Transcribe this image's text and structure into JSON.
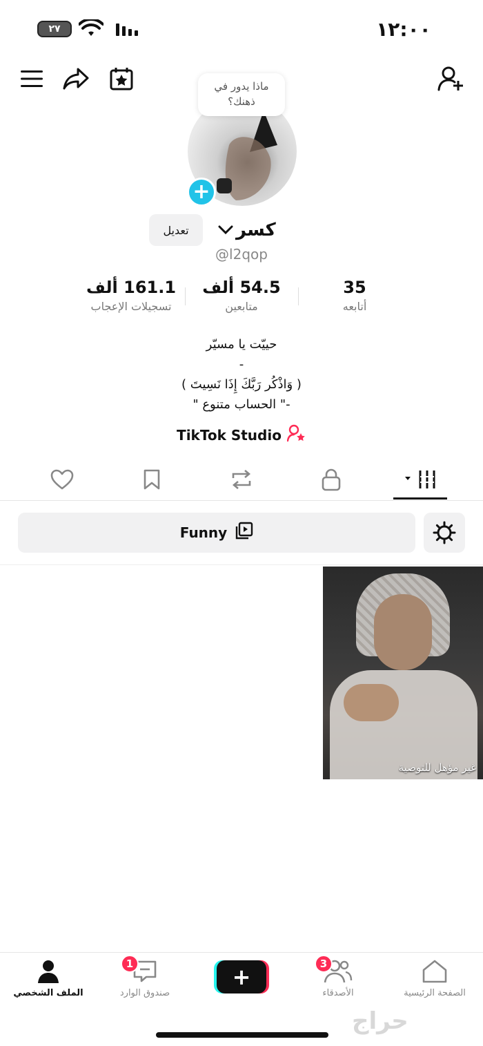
{
  "status_bar": {
    "time": "١٢:٠٠",
    "battery": "٢٧"
  },
  "avatar_prompt": {
    "line1": "ماذا يدور في",
    "line2": "ذهنك؟"
  },
  "profile": {
    "edit_label": "تعديل",
    "name": "كسر",
    "handle": "@l2qop"
  },
  "stats": {
    "likes": {
      "value": "161.1 ألف",
      "label": "تسجيلات الإعجاب"
    },
    "followers": {
      "value": "54.5 ألف",
      "label": "متابعين"
    },
    "following": {
      "value": "35",
      "label": "أتابعه"
    }
  },
  "bio": {
    "line1": "حييّت يا مسيّر",
    "line2": "-",
    "line3": "( وَاذْكُر رَبَّكَ إِذَا نَسِيتَ )",
    "line4": "-\" الحساب متنوع \""
  },
  "studio_link": "TikTok Studio",
  "playlist": {
    "label": "Funny"
  },
  "video": {
    "caption": "غير مؤهل للتوصية"
  },
  "bottom_nav": {
    "profile": "الملف الشخصي",
    "inbox": "صندوق الوارد",
    "inbox_badge": "1",
    "friends": "الأصدقاء",
    "friends_badge": "3",
    "home": "الصفحة الرئيسية"
  },
  "watermark": "حراج",
  "colors": {
    "accent_cyan": "#21c3e8",
    "accent_red": "#fe2c55",
    "text": "#111111",
    "muted": "#888888"
  }
}
